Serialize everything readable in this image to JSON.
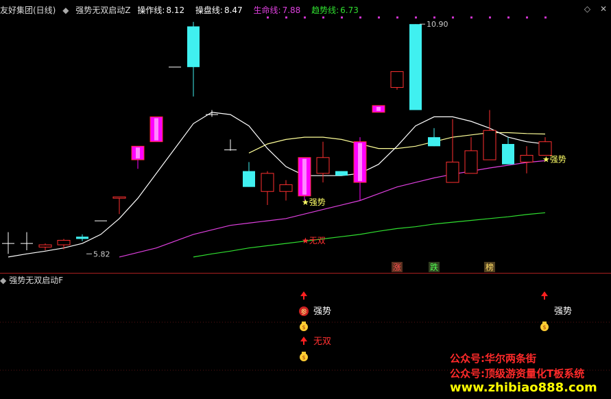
{
  "header": {
    "stock_name": "友好集团(日线)",
    "indicator_name": "强势无双启动Z",
    "lines": [
      {
        "label": "操作线:",
        "value": "8.12",
        "color": "#ffffff"
      },
      {
        "label": "操盘线:",
        "value": "8.47",
        "color": "#ffffff"
      },
      {
        "label": "生命线:",
        "value": "7.88",
        "color": "#e040e0"
      },
      {
        "label": "趋势线:",
        "value": "6.73",
        "color": "#30e030"
      }
    ],
    "corner_icons": [
      "diamond-icon",
      "close-icon"
    ]
  },
  "sub_panel": {
    "title": "强势无双启动F"
  },
  "watermark": {
    "line1": "公众号:华尔两条街",
    "line2": "公众号:顶级游资量化T板系统",
    "line3": "www.zhibiao888.com"
  },
  "colors": {
    "up": "#ff3030",
    "up_big": "#ff00ff",
    "down_big": "#40f0f0",
    "ma_white": "#ffffff",
    "ma_yellow": "#ffff99",
    "life_line": "#e040e0",
    "trend_line": "#30e030"
  },
  "chart_data": {
    "type": "candlestick",
    "ylim": [
      5.4,
      11.1
    ],
    "candles": [
      {
        "o": 5.95,
        "h": 6.3,
        "l": 5.82,
        "c": 6.05,
        "t": "doji"
      },
      {
        "o": 6.05,
        "h": 6.3,
        "l": 5.9,
        "c": 6.05,
        "t": "doji"
      },
      {
        "o": 5.97,
        "h": 6.05,
        "l": 5.9,
        "c": 6.02,
        "t": "up"
      },
      {
        "o": 6.02,
        "h": 6.15,
        "l": 5.92,
        "c": 6.12,
        "t": "up"
      },
      {
        "o": 6.2,
        "h": 6.25,
        "l": 6.1,
        "c": 6.15,
        "t": "down_big"
      },
      {
        "o": 6.55,
        "h": 6.55,
        "l": 6.55,
        "c": 6.55,
        "t": "doji"
      },
      {
        "o": 7.05,
        "h": 7.08,
        "l": 6.7,
        "c": 7.08,
        "t": "up"
      },
      {
        "o": 7.9,
        "h": 8.0,
        "l": 7.7,
        "c": 8.2,
        "t": "up_big"
      },
      {
        "o": 8.3,
        "h": 8.3,
        "l": 8.3,
        "c": 8.85,
        "t": "up_big"
      },
      {
        "o": 9.95,
        "h": 9.95,
        "l": 9.95,
        "c": 9.95,
        "t": "doji"
      },
      {
        "o": 10.85,
        "h": 10.95,
        "l": 9.3,
        "c": 9.95,
        "t": "down_big"
      },
      {
        "o": 8.9,
        "h": 9.0,
        "l": 8.85,
        "c": 8.9,
        "t": "doji"
      },
      {
        "o": 8.1,
        "h": 8.35,
        "l": 8.1,
        "c": 8.12,
        "t": "doji"
      },
      {
        "o": 7.65,
        "h": 7.85,
        "l": 7.3,
        "c": 7.3,
        "t": "down_big"
      },
      {
        "o": 7.2,
        "h": 7.65,
        "l": 6.9,
        "c": 7.6,
        "t": "up"
      },
      {
        "o": 7.2,
        "h": 7.45,
        "l": 7.0,
        "c": 7.35,
        "t": "up"
      },
      {
        "o": 7.1,
        "h": 7.95,
        "l": 7.0,
        "c": 7.95,
        "t": "up_big"
      },
      {
        "o": 7.6,
        "h": 8.3,
        "l": 7.4,
        "c": 7.95,
        "t": "up"
      },
      {
        "o": 7.65,
        "h": 7.65,
        "l": 7.55,
        "c": 7.55,
        "t": "down_big"
      },
      {
        "o": 7.4,
        "h": 8.4,
        "l": 7.0,
        "c": 8.3,
        "t": "up_big"
      },
      {
        "o": 8.95,
        "h": 9.0,
        "l": 8.95,
        "c": 9.1,
        "t": "up_big"
      },
      {
        "o": 9.5,
        "h": 9.85,
        "l": 9.45,
        "c": 9.85,
        "t": "up"
      },
      {
        "o": 10.9,
        "h": 10.9,
        "l": 9.0,
        "c": 9.0,
        "t": "down_big"
      },
      {
        "o": 8.4,
        "h": 8.6,
        "l": 8.2,
        "c": 8.2,
        "t": "down_big"
      },
      {
        "o": 7.4,
        "h": 8.8,
        "l": 7.4,
        "c": 7.85,
        "t": "up"
      },
      {
        "o": 7.6,
        "h": 8.4,
        "l": 7.6,
        "c": 8.1,
        "t": "up"
      },
      {
        "o": 7.9,
        "h": 9.0,
        "l": 7.9,
        "c": 8.55,
        "t": "up"
      },
      {
        "o": 8.25,
        "h": 8.4,
        "l": 7.8,
        "c": 7.8,
        "t": "down_big"
      },
      {
        "o": 7.85,
        "h": 8.2,
        "l": 7.6,
        "c": 8.0,
        "t": "up"
      },
      {
        "o": 8.0,
        "h": 8.4,
        "l": 8.0,
        "c": 8.3,
        "t": "up"
      }
    ],
    "ma_white": [
      5.75,
      5.82,
      5.88,
      5.95,
      6.05,
      6.25,
      6.6,
      7.05,
      7.6,
      8.15,
      8.7,
      8.95,
      8.9,
      8.65,
      8.15,
      7.75,
      7.55,
      7.55,
      7.55,
      7.6,
      7.8,
      8.2,
      8.65,
      8.85,
      8.85,
      8.75,
      8.6,
      8.4,
      8.3,
      8.25
    ],
    "ma_yellow": [
      null,
      null,
      null,
      null,
      null,
      null,
      null,
      null,
      null,
      null,
      null,
      null,
      null,
      8.05,
      8.25,
      8.35,
      8.4,
      8.4,
      8.35,
      8.25,
      8.15,
      8.15,
      8.2,
      8.3,
      8.4,
      8.45,
      8.5,
      8.5,
      8.48,
      8.47
    ],
    "life_line": [
      null,
      null,
      null,
      null,
      null,
      null,
      5.75,
      5.85,
      5.95,
      6.1,
      6.25,
      6.35,
      6.45,
      6.5,
      6.55,
      6.6,
      6.7,
      6.8,
      6.9,
      7.0,
      7.15,
      7.3,
      7.4,
      7.5,
      7.58,
      7.65,
      7.72,
      7.78,
      7.84,
      7.88
    ],
    "trend_line": [
      null,
      null,
      null,
      null,
      null,
      null,
      null,
      null,
      null,
      null,
      5.75,
      5.82,
      5.88,
      5.95,
      6.0,
      6.05,
      6.1,
      6.15,
      6.2,
      6.25,
      6.32,
      6.38,
      6.42,
      6.48,
      6.52,
      6.56,
      6.6,
      6.64,
      6.69,
      6.73
    ],
    "annotations": [
      {
        "i": 4,
        "text": "5.82",
        "y": 5.82
      },
      {
        "i": 22,
        "text": "10.90",
        "y": 10.9
      }
    ],
    "signals_main": [
      {
        "i": 16,
        "text": "强势",
        "y": 6.9,
        "color": "#ffff66"
      },
      {
        "i": 16,
        "text": "无双",
        "y": 6.05,
        "color": "#ff3030"
      },
      {
        "i": 29,
        "text": "强势",
        "y": 7.85,
        "color": "#ffff66"
      }
    ],
    "bottom_labels": [
      {
        "i": 21,
        "text": "涨",
        "color": "#ff5050",
        "bg": "#5a3020"
      },
      {
        "i": 23,
        "text": "跌",
        "color": "#50ff50",
        "bg": "#304020"
      },
      {
        "i": 26,
        "text": "榜",
        "color": "#ffdd66",
        "bg": "#504020"
      }
    ],
    "sub_signals": [
      {
        "i": 16,
        "arrows": [
          1,
          4
        ],
        "icons": [
          {
            "row": 2,
            "kind": "zhu",
            "text": "参"
          },
          {
            "row": 3,
            "kind": "bag"
          },
          {
            "row": 5,
            "kind": "bag"
          }
        ],
        "labels": [
          {
            "row": 2,
            "text": "强势",
            "color": "#ffffff"
          },
          {
            "row": 4,
            "text": "无双",
            "color": "#ff3030"
          }
        ]
      },
      {
        "i": 29,
        "arrows": [
          1
        ],
        "icons": [
          {
            "row": 3,
            "kind": "bag"
          }
        ],
        "labels": [
          {
            "row": 2,
            "text": "强势",
            "color": "#ffffff"
          }
        ]
      }
    ]
  }
}
